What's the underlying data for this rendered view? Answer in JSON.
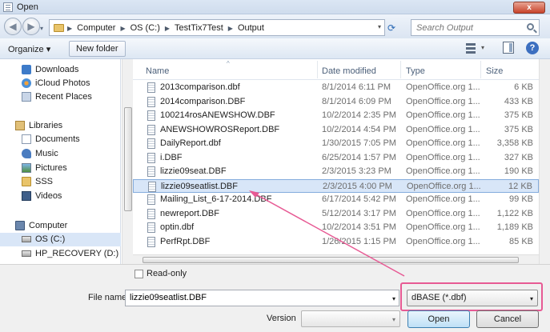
{
  "window": {
    "title": "Open",
    "close_label": "x"
  },
  "address": {
    "back_glyph": "◀",
    "forward_glyph": "▶",
    "crumbs": [
      "Computer",
      "OS (C:)",
      "TestTix7Test",
      "Output"
    ],
    "separator": "▶",
    "dropdown_glyph": "▾",
    "refresh_glyph": "⟳"
  },
  "search": {
    "placeholder": "Search Output"
  },
  "toolbar": {
    "organize_label": "Organize ▾",
    "new_folder_label": "New folder",
    "views_drop": "▾",
    "help_label": "?"
  },
  "sidebar": {
    "items": [
      {
        "label": "Downloads",
        "icon": "downloads-icon"
      },
      {
        "label": "iCloud Photos",
        "icon": "icloud-photos-icon"
      },
      {
        "label": "Recent Places",
        "icon": "recent-places-icon"
      },
      {
        "label": "Libraries",
        "icon": "libraries-icon"
      },
      {
        "label": "Documents",
        "icon": "documents-icon"
      },
      {
        "label": "Music",
        "icon": "music-icon"
      },
      {
        "label": "Pictures",
        "icon": "pictures-icon"
      },
      {
        "label": "SSS",
        "icon": "folder-icon"
      },
      {
        "label": "Videos",
        "icon": "videos-icon"
      },
      {
        "label": "Computer",
        "icon": "computer-icon"
      },
      {
        "label": "OS (C:)",
        "icon": "drive-icon"
      },
      {
        "label": "HP_RECOVERY (D:)",
        "icon": "drive-icon"
      }
    ]
  },
  "columns": {
    "name": "Name",
    "date": "Date modified",
    "type": "Type",
    "size": "Size",
    "sort_glyph": "^"
  },
  "files": [
    {
      "name": "2013comparison.dbf",
      "date": "8/1/2014 6:11 PM",
      "type": "OpenOffice.org 1...",
      "size": "6 KB"
    },
    {
      "name": "2014comparison.DBF",
      "date": "8/1/2014 6:09 PM",
      "type": "OpenOffice.org 1...",
      "size": "433 KB"
    },
    {
      "name": "100214rosANEWSHOW.DBF",
      "date": "10/2/2014 2:35 PM",
      "type": "OpenOffice.org 1...",
      "size": "375 KB"
    },
    {
      "name": "ANEWSHOWROSReport.DBF",
      "date": "10/2/2014 4:54 PM",
      "type": "OpenOffice.org 1...",
      "size": "375 KB"
    },
    {
      "name": "DailyReport.dbf",
      "date": "1/30/2015 7:05 PM",
      "type": "OpenOffice.org 1...",
      "size": "3,358 KB"
    },
    {
      "name": "i.DBF",
      "date": "6/25/2014 1:57 PM",
      "type": "OpenOffice.org 1...",
      "size": "327 KB"
    },
    {
      "name": "lizzie09seat.DBF",
      "date": "2/3/2015 3:23 PM",
      "type": "OpenOffice.org 1...",
      "size": "190 KB"
    },
    {
      "name": "lizzie09seatlist.DBF",
      "date": "2/3/2015 4:00 PM",
      "type": "OpenOffice.org 1...",
      "size": "12 KB"
    },
    {
      "name": "Mailing_List_6-17-2014.DBF",
      "date": "6/17/2014 5:42 PM",
      "type": "OpenOffice.org 1...",
      "size": "99 KB"
    },
    {
      "name": "newreport.DBF",
      "date": "5/12/2014 3:17 PM",
      "type": "OpenOffice.org 1...",
      "size": "1,122 KB"
    },
    {
      "name": "optin.dbf",
      "date": "10/2/2014 3:51 PM",
      "type": "OpenOffice.org 1...",
      "size": "1,189 KB"
    },
    {
      "name": "PerfRpt.DBF",
      "date": "1/26/2015 1:15 PM",
      "type": "OpenOffice.org 1...",
      "size": "85 KB"
    }
  ],
  "selected_file_index": 7,
  "bottom": {
    "read_only_label": "Read-only",
    "file_name_label": "File name:",
    "file_name_value": "lizzie09seatlist.DBF",
    "file_type_value": "dBASE (*.dbf)",
    "version_label": "Version",
    "open_label": "Open",
    "cancel_label": "Cancel",
    "drop_glyph": "▾"
  },
  "colors": {
    "annotation": "#e75a94",
    "selection": "#d8e6f8"
  }
}
